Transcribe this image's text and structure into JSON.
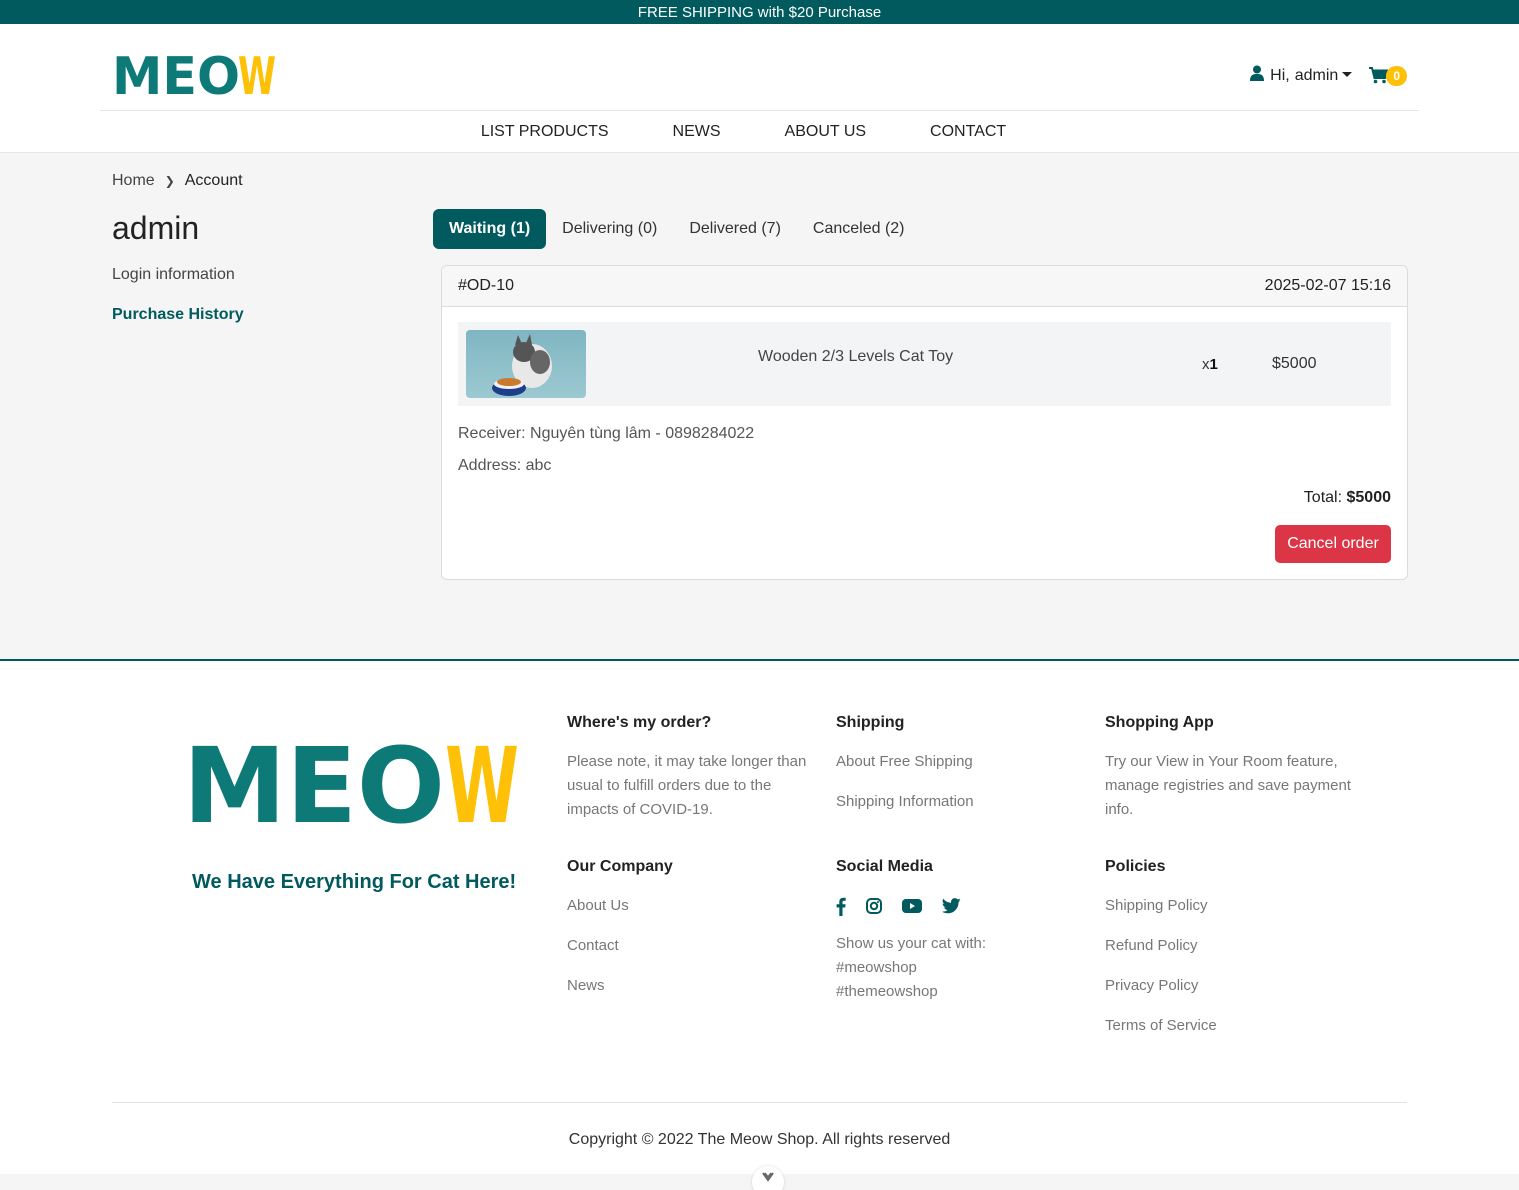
{
  "promo_bar": {
    "text": "FREE SHIPPING with $20 Purchase"
  },
  "brand": {
    "logo_main": "MEO",
    "logo_accent": "W",
    "primary_color": "#005a5e",
    "accent_color": "#ffc107",
    "logo_teal": "#0e7a78"
  },
  "header": {
    "greeting": "Hi,",
    "username": "admin",
    "cart_count": "0",
    "icons": {
      "user": "user-icon",
      "cart": "cart-icon",
      "dropdown": "caret-down-icon"
    }
  },
  "nav": {
    "items": [
      "LIST PRODUCTS",
      "NEWS",
      "ABOUT US",
      "CONTACT"
    ]
  },
  "breadcrumb": {
    "home": "Home",
    "current": "Account"
  },
  "account": {
    "name": "admin",
    "menu": [
      "Login information",
      "Purchase History"
    ],
    "active_menu": "Purchase History"
  },
  "order_tabs": [
    {
      "label": "Waiting (1)",
      "active": true
    },
    {
      "label": "Delivering (0)",
      "active": false
    },
    {
      "label": "Delivered (7)",
      "active": false
    },
    {
      "label": "Canceled (2)",
      "active": false
    }
  ],
  "order": {
    "id": "#OD-10",
    "datetime": "2025-02-07 15:16",
    "item": {
      "name": "Wooden 2/3 Levels Cat Toy",
      "qty_prefix": "x",
      "qty": "1",
      "price": "$5000"
    },
    "receiver": "Receiver: Nguyên tùng lâm - 0898284022",
    "address": "Address: abc",
    "total_label": "Total:",
    "total_value": "$5000",
    "cancel_label": "Cancel order",
    "cancel_color": "#dc3545"
  },
  "footer": {
    "slogan": "We Have Everything For Cat Here!",
    "where_order": {
      "title": "Where's my order?",
      "text": "Please note, it may take longer than usual to fulfill orders due to the impacts of COVID-19."
    },
    "shipping": {
      "title": "Shipping",
      "links": [
        "About Free Shipping",
        "Shipping Information"
      ]
    },
    "shopping_app": {
      "title": "Shopping App",
      "text": "Try our View in Your Room feature, manage registries and save payment info."
    },
    "company": {
      "title": "Our Company",
      "links": [
        "About Us",
        "Contact",
        "News"
      ]
    },
    "social": {
      "title": "Social Media",
      "icons": [
        "facebook-icon",
        "instagram-icon",
        "youtube-icon",
        "twitter-icon"
      ],
      "text1": "Show us your cat with:",
      "text2": "#meowshop",
      "text3": "#themeowshop"
    },
    "policies": {
      "title": "Policies",
      "links": [
        "Shipping Policy",
        "Refund Policy",
        "Privacy Policy",
        "Terms of Service"
      ]
    },
    "copyright": "Copyright © 2022 The Meow Shop. All rights reserved"
  }
}
